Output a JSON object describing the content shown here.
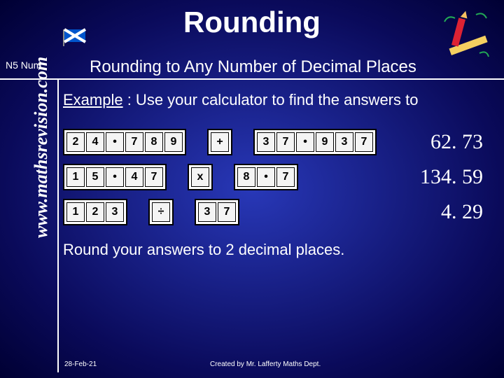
{
  "title": "Rounding",
  "subtitle": "Rounding to Any Number of Decimal Places",
  "tag": "N5 Num",
  "sidetext": "www.mathsrevision.com",
  "example_label": "Example",
  "example_text": " : Use your calculator to find the answers to",
  "rows": [
    {
      "keys": [
        "2",
        "4",
        "•",
        "7",
        "8",
        "9",
        " ",
        "+",
        " ",
        "3",
        "7",
        "•",
        "9",
        "3",
        "7"
      ],
      "answer": "62. 73"
    },
    {
      "keys": [
        "1",
        "5",
        "•",
        "4",
        "7",
        " ",
        "x",
        " ",
        "8",
        "•",
        "7"
      ],
      "answer": "134. 59"
    },
    {
      "keys": [
        "1",
        "2",
        "3",
        " ",
        "÷",
        " ",
        "3",
        "7"
      ],
      "answer": "4. 29"
    }
  ],
  "instruction": "Round your answers to 2 decimal places.",
  "footer_date": "28-Feb-21",
  "footer_credit": "Created by Mr. Lafferty Maths Dept."
}
